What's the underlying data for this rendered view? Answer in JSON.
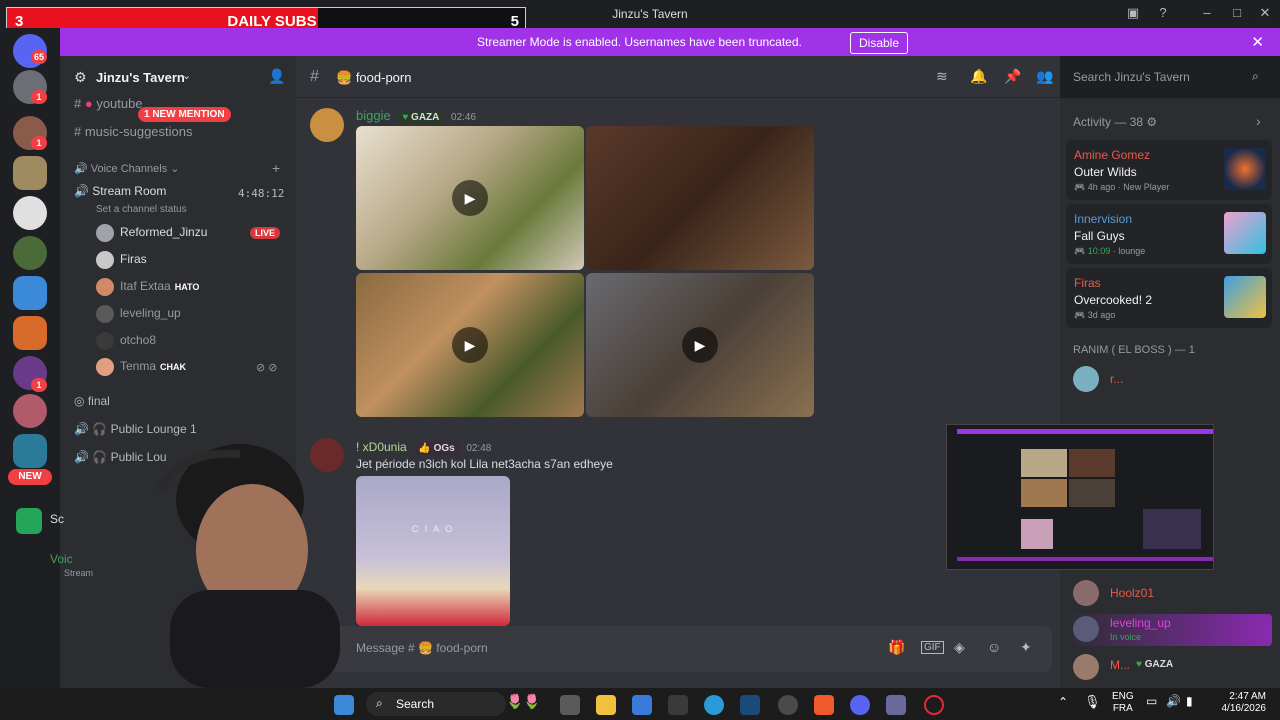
{
  "window": {
    "title": "Jinzu's Tavern"
  },
  "daily_subs": {
    "left": "3",
    "title": "DAILY SUBS",
    "right": "5",
    "progress": 0.6
  },
  "banner": {
    "text": "Streamer Mode is enabled. Usernames have been truncated.",
    "button": "Disable"
  },
  "rail": {
    "top_badge": "65",
    "badge": "1",
    "new_label": "NEW"
  },
  "sidebar": {
    "server_name": "Jinzu's Tavern",
    "mention_pill": "1 NEW MENTION",
    "channels": [
      "youtube",
      "music-suggestions"
    ],
    "voice_category": "Voice Channels",
    "stream_room": {
      "name": "Stream Room",
      "timer": "4:48:12",
      "status": "Set a channel status"
    },
    "voice_users": [
      {
        "name": "Reformed_Jinzu",
        "tag": "LIVE"
      },
      {
        "name": "Firas",
        "tag": ""
      },
      {
        "name": "Itaf Extaa",
        "tag": "HATO"
      },
      {
        "name": "leveling_up",
        "tag": ""
      },
      {
        "name": "otcho8",
        "tag": ""
      },
      {
        "name": "Tenma",
        "tag": "CHAK"
      }
    ],
    "more_channels": [
      "final",
      "Public Lounge 1",
      "Public Lou"
    ],
    "bottom_items": [
      "Sc",
      "Voic",
      "Stream"
    ]
  },
  "main": {
    "channel": "food-porn",
    "search_placeholder": "Search Jinzu's Tavern",
    "messages": [
      {
        "author": "biggie",
        "tag": "GAZA",
        "time": "02:46",
        "text": ""
      },
      {
        "author": "! xD0unia",
        "tag": "OGs",
        "time": "02:48",
        "text": "Jet période n3ich kol Lila net3acha s7an edheye",
        "image_caption": "C I A O"
      }
    ],
    "composer_placeholder": "Message # 🍔 food-porn"
  },
  "activity": {
    "header": "Activity — 38",
    "cards": [
      {
        "user": "Amine Gomez",
        "game": "Outer Wilds",
        "meta": "4h ago",
        "meta2": "New Player",
        "user_color": "#3ba55d"
      },
      {
        "user": "Innervision",
        "game": "Fall Guys",
        "meta": "10:09",
        "meta2": "lounge",
        "user_color": "#3ba55d"
      },
      {
        "user": "Firas",
        "game": "Overcooked! 2",
        "meta": "3d ago",
        "meta2": "",
        "user_color": "#f04747"
      }
    ],
    "group_label": "RANIM ( EL BOSS ) — 1",
    "group_user": "r...",
    "members": [
      {
        "name": "Hoolz01",
        "status": ""
      },
      {
        "name": "leveling_up",
        "status": "In voice"
      },
      {
        "name": "M...",
        "status": "GAZA"
      }
    ]
  },
  "taskbar": {
    "search": "Search",
    "lang1": "ENG",
    "lang2": "FRA",
    "time": "2:47 AM",
    "date": "4/16/2026"
  }
}
